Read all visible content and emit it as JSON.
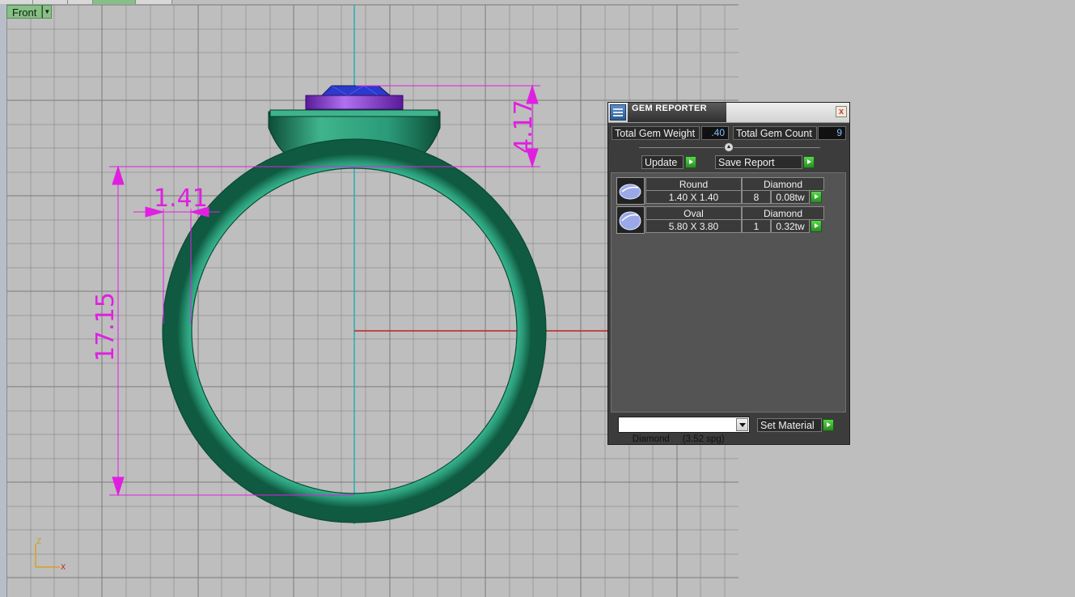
{
  "viewport": {
    "view_name": "Front",
    "axis_labels": {
      "z": "Z",
      "x": "X"
    },
    "dimensions": [
      "4.17",
      "1.41",
      "17.15"
    ],
    "colors": {
      "background": "#bebebe",
      "grid": "#7a7a7a",
      "dimension": "#e020e0",
      "ring_body": "#2a9a78",
      "gem_purple": "#8a2ad0",
      "gem_blue": "#2a3acc"
    }
  },
  "gem_reporter": {
    "title": "GEM REPORTER",
    "close_symbol": "x",
    "total_weight_label": "Total Gem Weight",
    "total_weight_value": ".40",
    "total_count_label": "Total Gem Count",
    "total_count_value": "9",
    "update_label": "Update",
    "save_report_label": "Save Report",
    "gems": [
      {
        "shape": "Round",
        "size": "1.40 X 1.40",
        "material": "Diamond",
        "count": "8",
        "weight": "0.08tw"
      },
      {
        "shape": "Oval",
        "size": "5.80 X 3.80",
        "material": "Diamond",
        "count": "1",
        "weight": "0.32tw"
      }
    ],
    "material_select": "Diamond     (3.52 spg)",
    "set_material_label": "Set Material"
  }
}
